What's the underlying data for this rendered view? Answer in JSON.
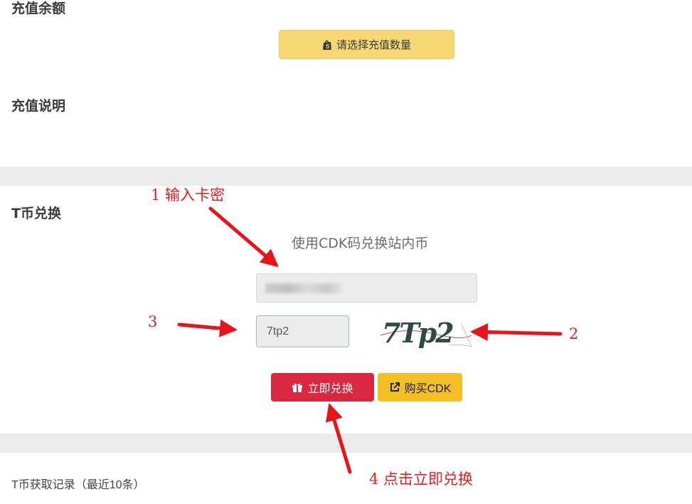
{
  "sections": {
    "recharge_balance": "充值余额",
    "recharge_notes": "充值说明",
    "t_coin_exchange": "T币兑换",
    "records": "T币获取记录（最近10条）"
  },
  "select_button": {
    "label": "请选择充值数量",
    "icon": "shopify-bag-icon"
  },
  "exchange": {
    "heading": "使用CDK码兑换站内币",
    "captcha_value": "7tp2",
    "captcha_image_text": "7Tp2",
    "redeem_label": "立即兑换",
    "redeem_icon": "gift-icon",
    "buy_label": "购买CDK",
    "buy_icon": "external-link-icon"
  },
  "annotations": {
    "step1": "1  输入卡密",
    "step2": "2",
    "step3": "3",
    "step4": "4  点击立即兑换"
  },
  "colors": {
    "select_button": "#f7d774",
    "redeem_button": "#d8273f",
    "buy_button": "#f4bf25",
    "annotation": "#e02020",
    "divider": "#ebebeb"
  }
}
